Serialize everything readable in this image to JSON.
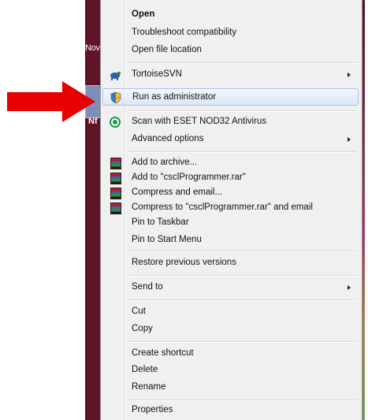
{
  "desktop": {
    "label_top": "Nov",
    "icon_label": "Nf"
  },
  "menu": {
    "items": [
      {
        "label": "Open",
        "bold": true
      },
      {
        "label": "Troubleshoot compatibility"
      },
      {
        "label": "Open file location"
      },
      {
        "label": "TortoiseSVN",
        "submenu": true,
        "icon": "tortoisesvn-icon"
      },
      {
        "label": "Run as administrator",
        "icon": "uac-shield-icon",
        "highlighted": true
      },
      {
        "label": "Scan with ESET NOD32 Antivirus",
        "icon": "eset-icon"
      },
      {
        "label": "Advanced options",
        "submenu": true
      },
      {
        "label": "Add to archive...",
        "icon": "winrar-icon"
      },
      {
        "label": "Add to \"csclProgrammer.rar\"",
        "icon": "winrar-icon"
      },
      {
        "label": "Compress and email...",
        "icon": "winrar-icon"
      },
      {
        "label": "Compress to \"csclProgrammer.rar\" and email",
        "icon": "winrar-icon"
      },
      {
        "label": "Pin to Taskbar"
      },
      {
        "label": "Pin to Start Menu"
      },
      {
        "label": "Restore previous versions"
      },
      {
        "label": "Send to",
        "submenu": true
      },
      {
        "label": "Cut"
      },
      {
        "label": "Copy"
      },
      {
        "label": "Create shortcut"
      },
      {
        "label": "Delete"
      },
      {
        "label": "Rename"
      },
      {
        "label": "Properties"
      }
    ]
  },
  "colors": {
    "pointer_arrow": "#e60000",
    "desktop": "#5e1326",
    "menu_bg": "#f0f0f0",
    "highlight": "#dce7f8"
  }
}
